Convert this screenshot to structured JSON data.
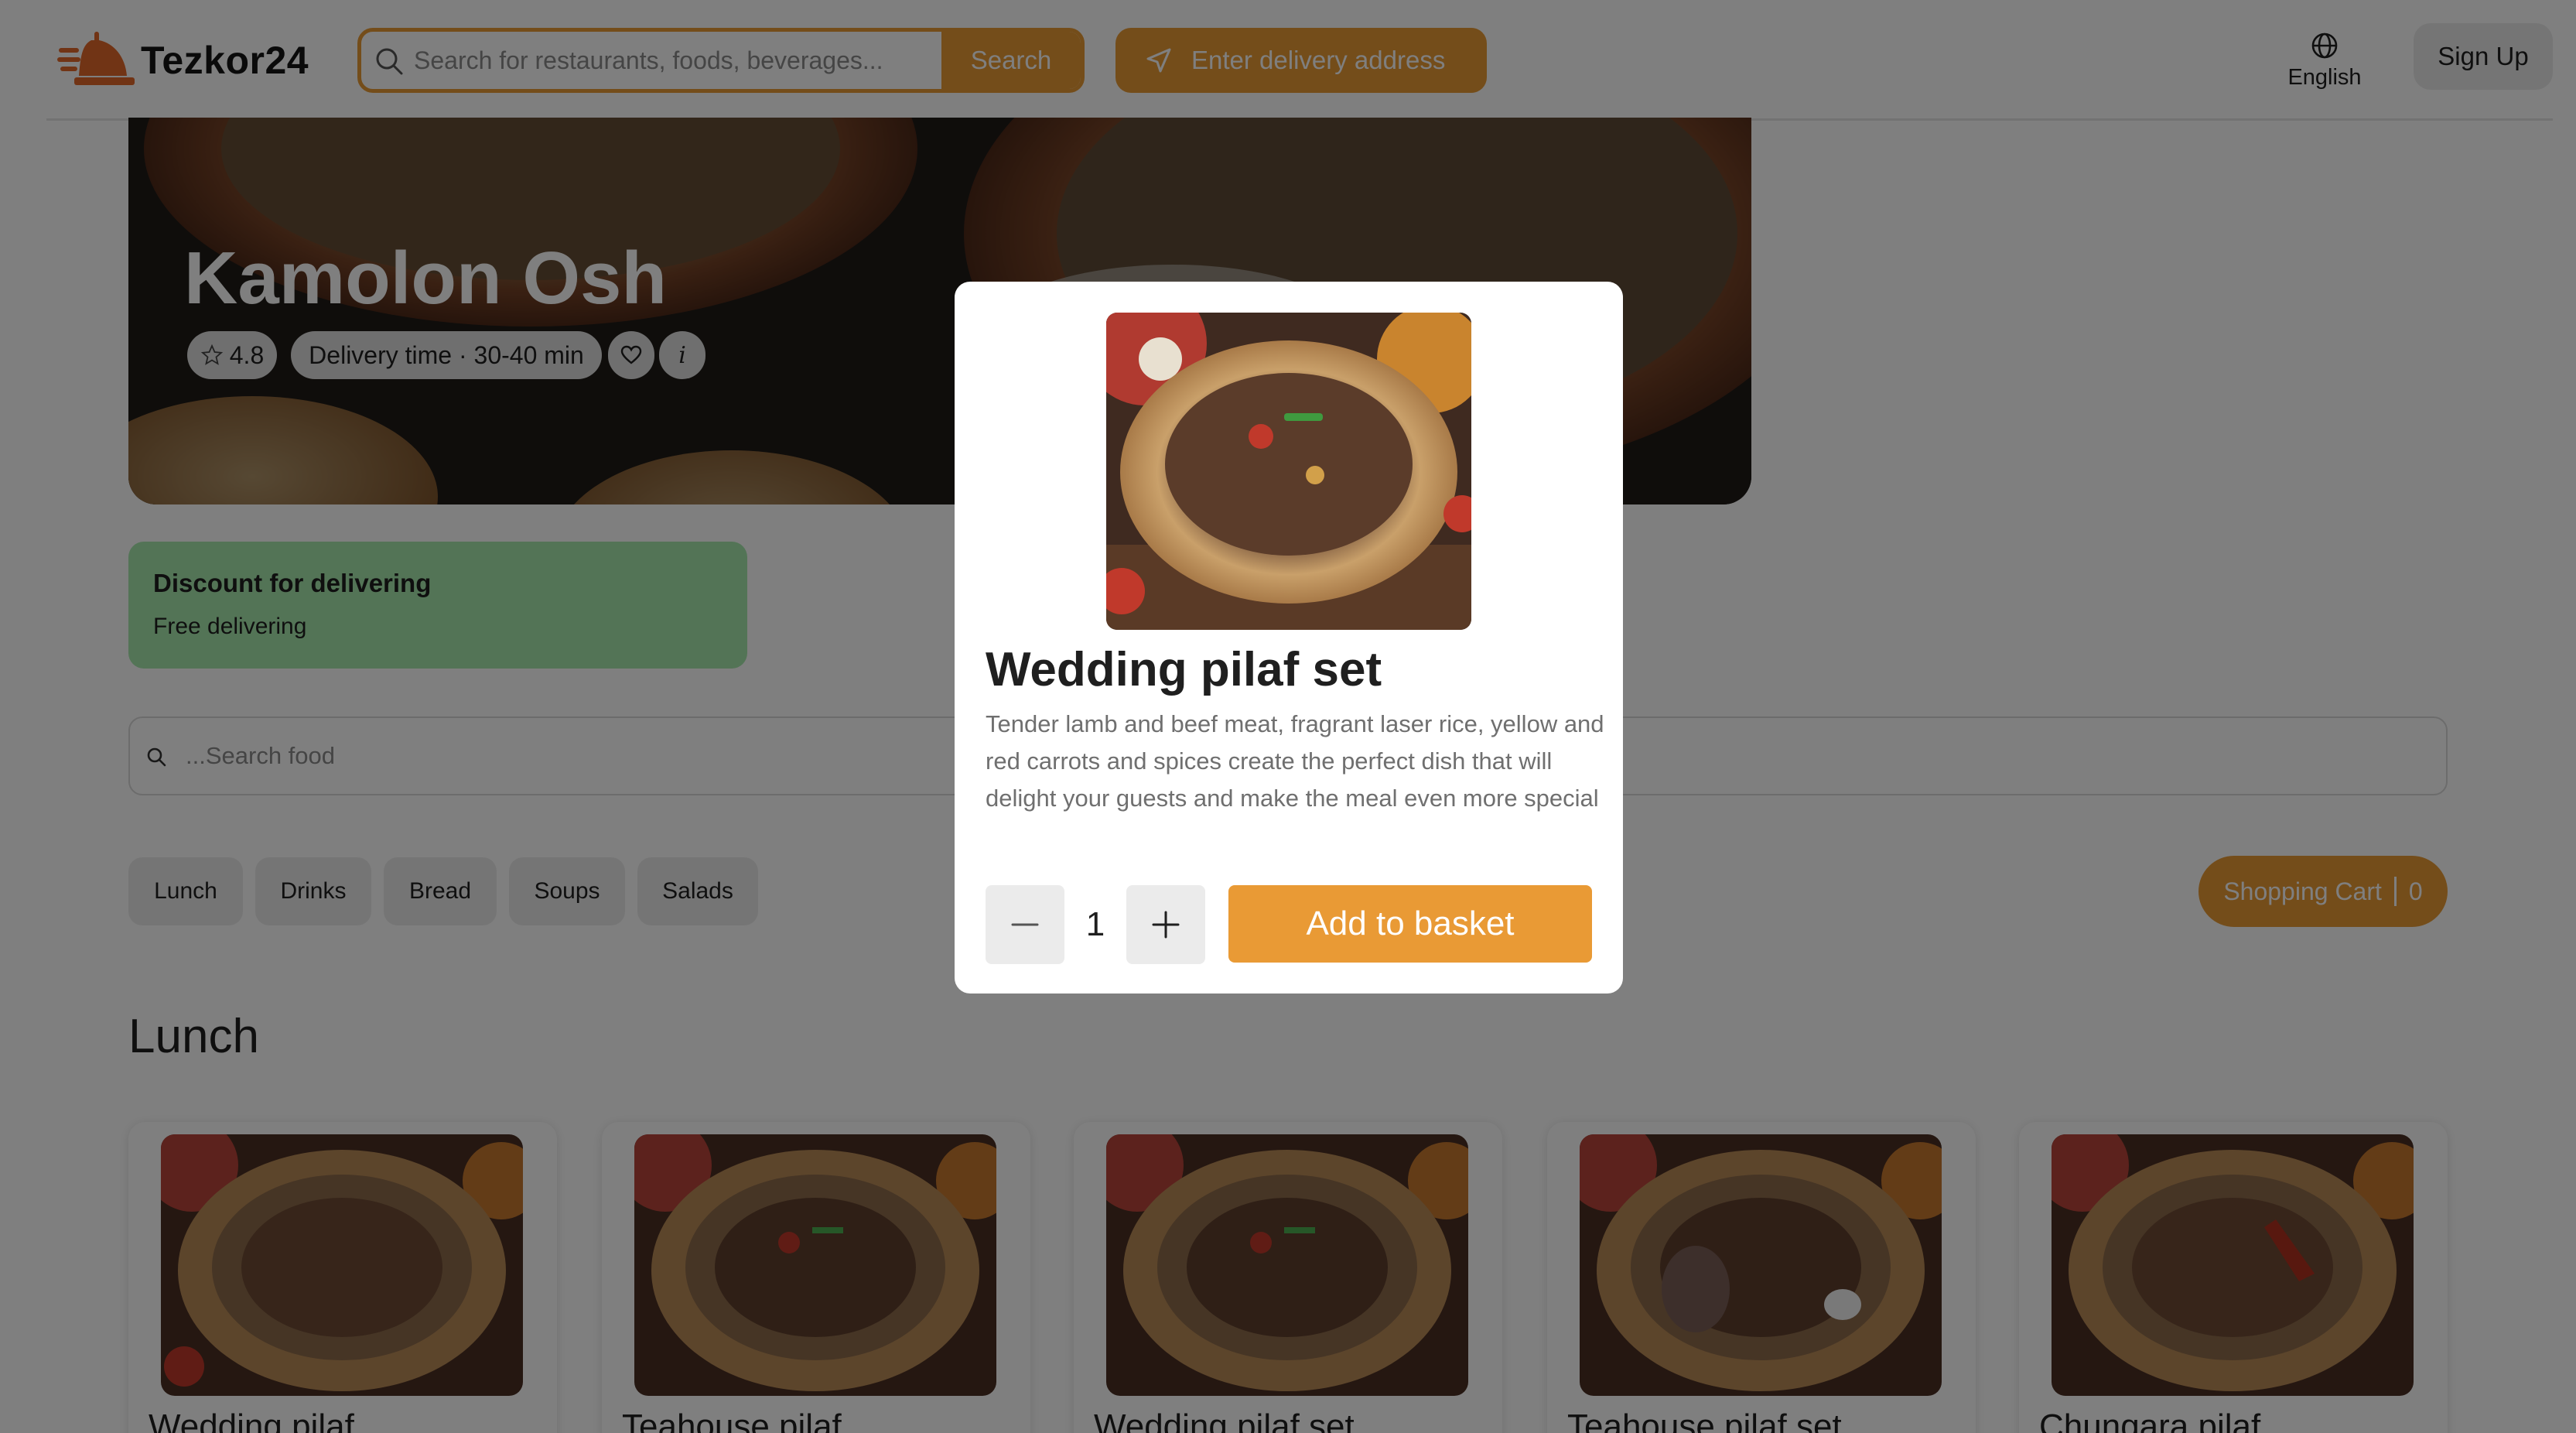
{
  "header": {
    "logo_text": "Tezkor24",
    "search_placeholder": "Search for restaurants, foods, beverages...",
    "search_button": "Search",
    "address_button": "Enter delivery address",
    "language": "English",
    "signup_button": "Sign Up"
  },
  "restaurant": {
    "name": "Kamolon Osh",
    "rating": "4.8",
    "delivery_time": "Delivery time · 30-40 min",
    "info_glyph": "i"
  },
  "discount": {
    "title": "Discount for delivering",
    "subtitle": "Free delivering"
  },
  "food_search": {
    "placeholder": "...Search food"
  },
  "categories": [
    "Lunch",
    "Drinks",
    "Bread",
    "Soups",
    "Salads"
  ],
  "cart": {
    "label": "Shopping Cart",
    "count": "0"
  },
  "section": {
    "title": "Lunch"
  },
  "products": [
    {
      "name": "Wedding pilaf"
    },
    {
      "name": "Teahouse pilaf"
    },
    {
      "name": "Wedding pilaf set"
    },
    {
      "name": "Teahouse pilaf set"
    },
    {
      "name": "Chungara pilaf"
    }
  ],
  "modal": {
    "title": "Wedding pilaf set",
    "description": "Tender lamb and beef meat, fragrant laser rice, yellow and red carrots and spices create the perfect dish that will delight your guests and make the meal even more special",
    "quantity": "1",
    "add_button": "Add to basket"
  },
  "colors": {
    "accent": "#e99a35",
    "discount_bg": "#a6e8ad",
    "chip_bg": "#dedede",
    "button_gray": "#ebebeb",
    "overlay": "rgba(0,0,0,0.5)"
  },
  "icons": {
    "logo": "delivery-bell-icon",
    "search": "search-icon",
    "address": "navigation-arrow-icon",
    "language": "globe-icon",
    "rating": "star-icon",
    "favorite": "heart-icon",
    "info": "info-icon",
    "minus": "minus-icon",
    "plus": "plus-icon"
  }
}
